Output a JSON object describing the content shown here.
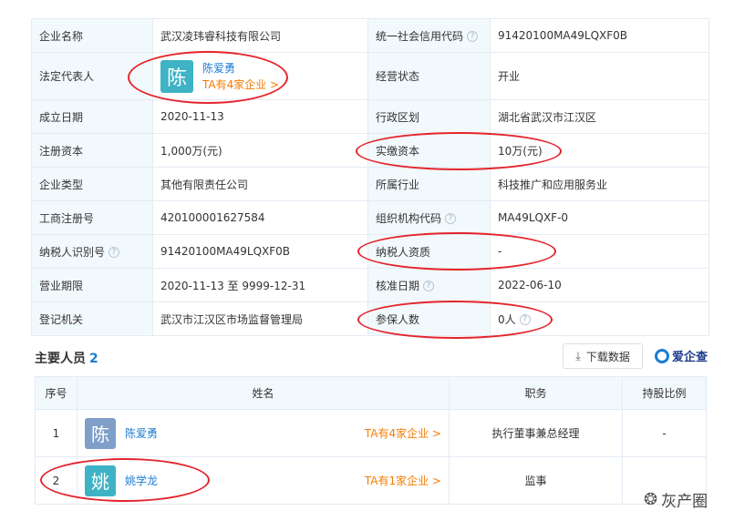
{
  "company_info": {
    "rows": [
      {
        "l1": "企业名称",
        "v1": "武汉凌玮睿科技有限公司",
        "l2": "统一社会信用代码",
        "v2": "91420100MA49LQXF0B"
      },
      {
        "l1": "法定代表人",
        "l2": "经营状态",
        "v2": "开业"
      },
      {
        "l1": "成立日期",
        "v1": "2020-11-13",
        "l2": "行政区划",
        "v2": "湖北省武汉市江汉区"
      },
      {
        "l1": "注册资本",
        "v1": "1,000万(元)",
        "l2": "实缴资本",
        "v2": "10万(元)"
      },
      {
        "l1": "企业类型",
        "v1": "其他有限责任公司",
        "l2": "所属行业",
        "v2": "科技推广和应用服务业"
      },
      {
        "l1": "工商注册号",
        "v1": "420100001627584",
        "l2": "组织机构代码",
        "v2": "MA49LQXF-0"
      },
      {
        "l1": "纳税人识别号",
        "v1": "91420100MA49LQXF0B",
        "l2": "纳税人资质",
        "v2": "-"
      },
      {
        "l1": "营业期限",
        "v1": "2020-11-13 至 9999-12-31",
        "l2": "核准日期",
        "v2": "2022-06-10"
      },
      {
        "l1": "登记机关",
        "v1": "武汉市江汉区市场监督管理局",
        "l2": "参保人数",
        "v2": "0人"
      }
    ],
    "legal_rep": {
      "avatar_char": "陈",
      "name": "陈爱勇",
      "link": "TA有4家企业 >"
    },
    "help_icon_glyph": "?"
  },
  "people_section": {
    "title": "主要人员",
    "count": "2",
    "download_label": "下载数据",
    "brand": "爱企查",
    "columns": [
      "序号",
      "姓名",
      "职务",
      "持股比例"
    ],
    "rows": [
      {
        "index": "1",
        "avatar_char": "陈",
        "avatar_color": "#7f9fc9",
        "name": "陈爱勇",
        "link": "TA有4家企业 >",
        "position": "执行董事兼总经理",
        "share": "-"
      },
      {
        "index": "2",
        "avatar_char": "姚",
        "avatar_color": "#3eb3c5",
        "name": "姚学龙",
        "link": "TA有1家企业 >",
        "position": "监事",
        "share": ""
      }
    ]
  },
  "watermark": {
    "text": "灰产圈"
  },
  "colors": {
    "highlight_red": "#e4252c",
    "link_blue": "#1c7cd3",
    "link_orange": "#f57c00"
  }
}
